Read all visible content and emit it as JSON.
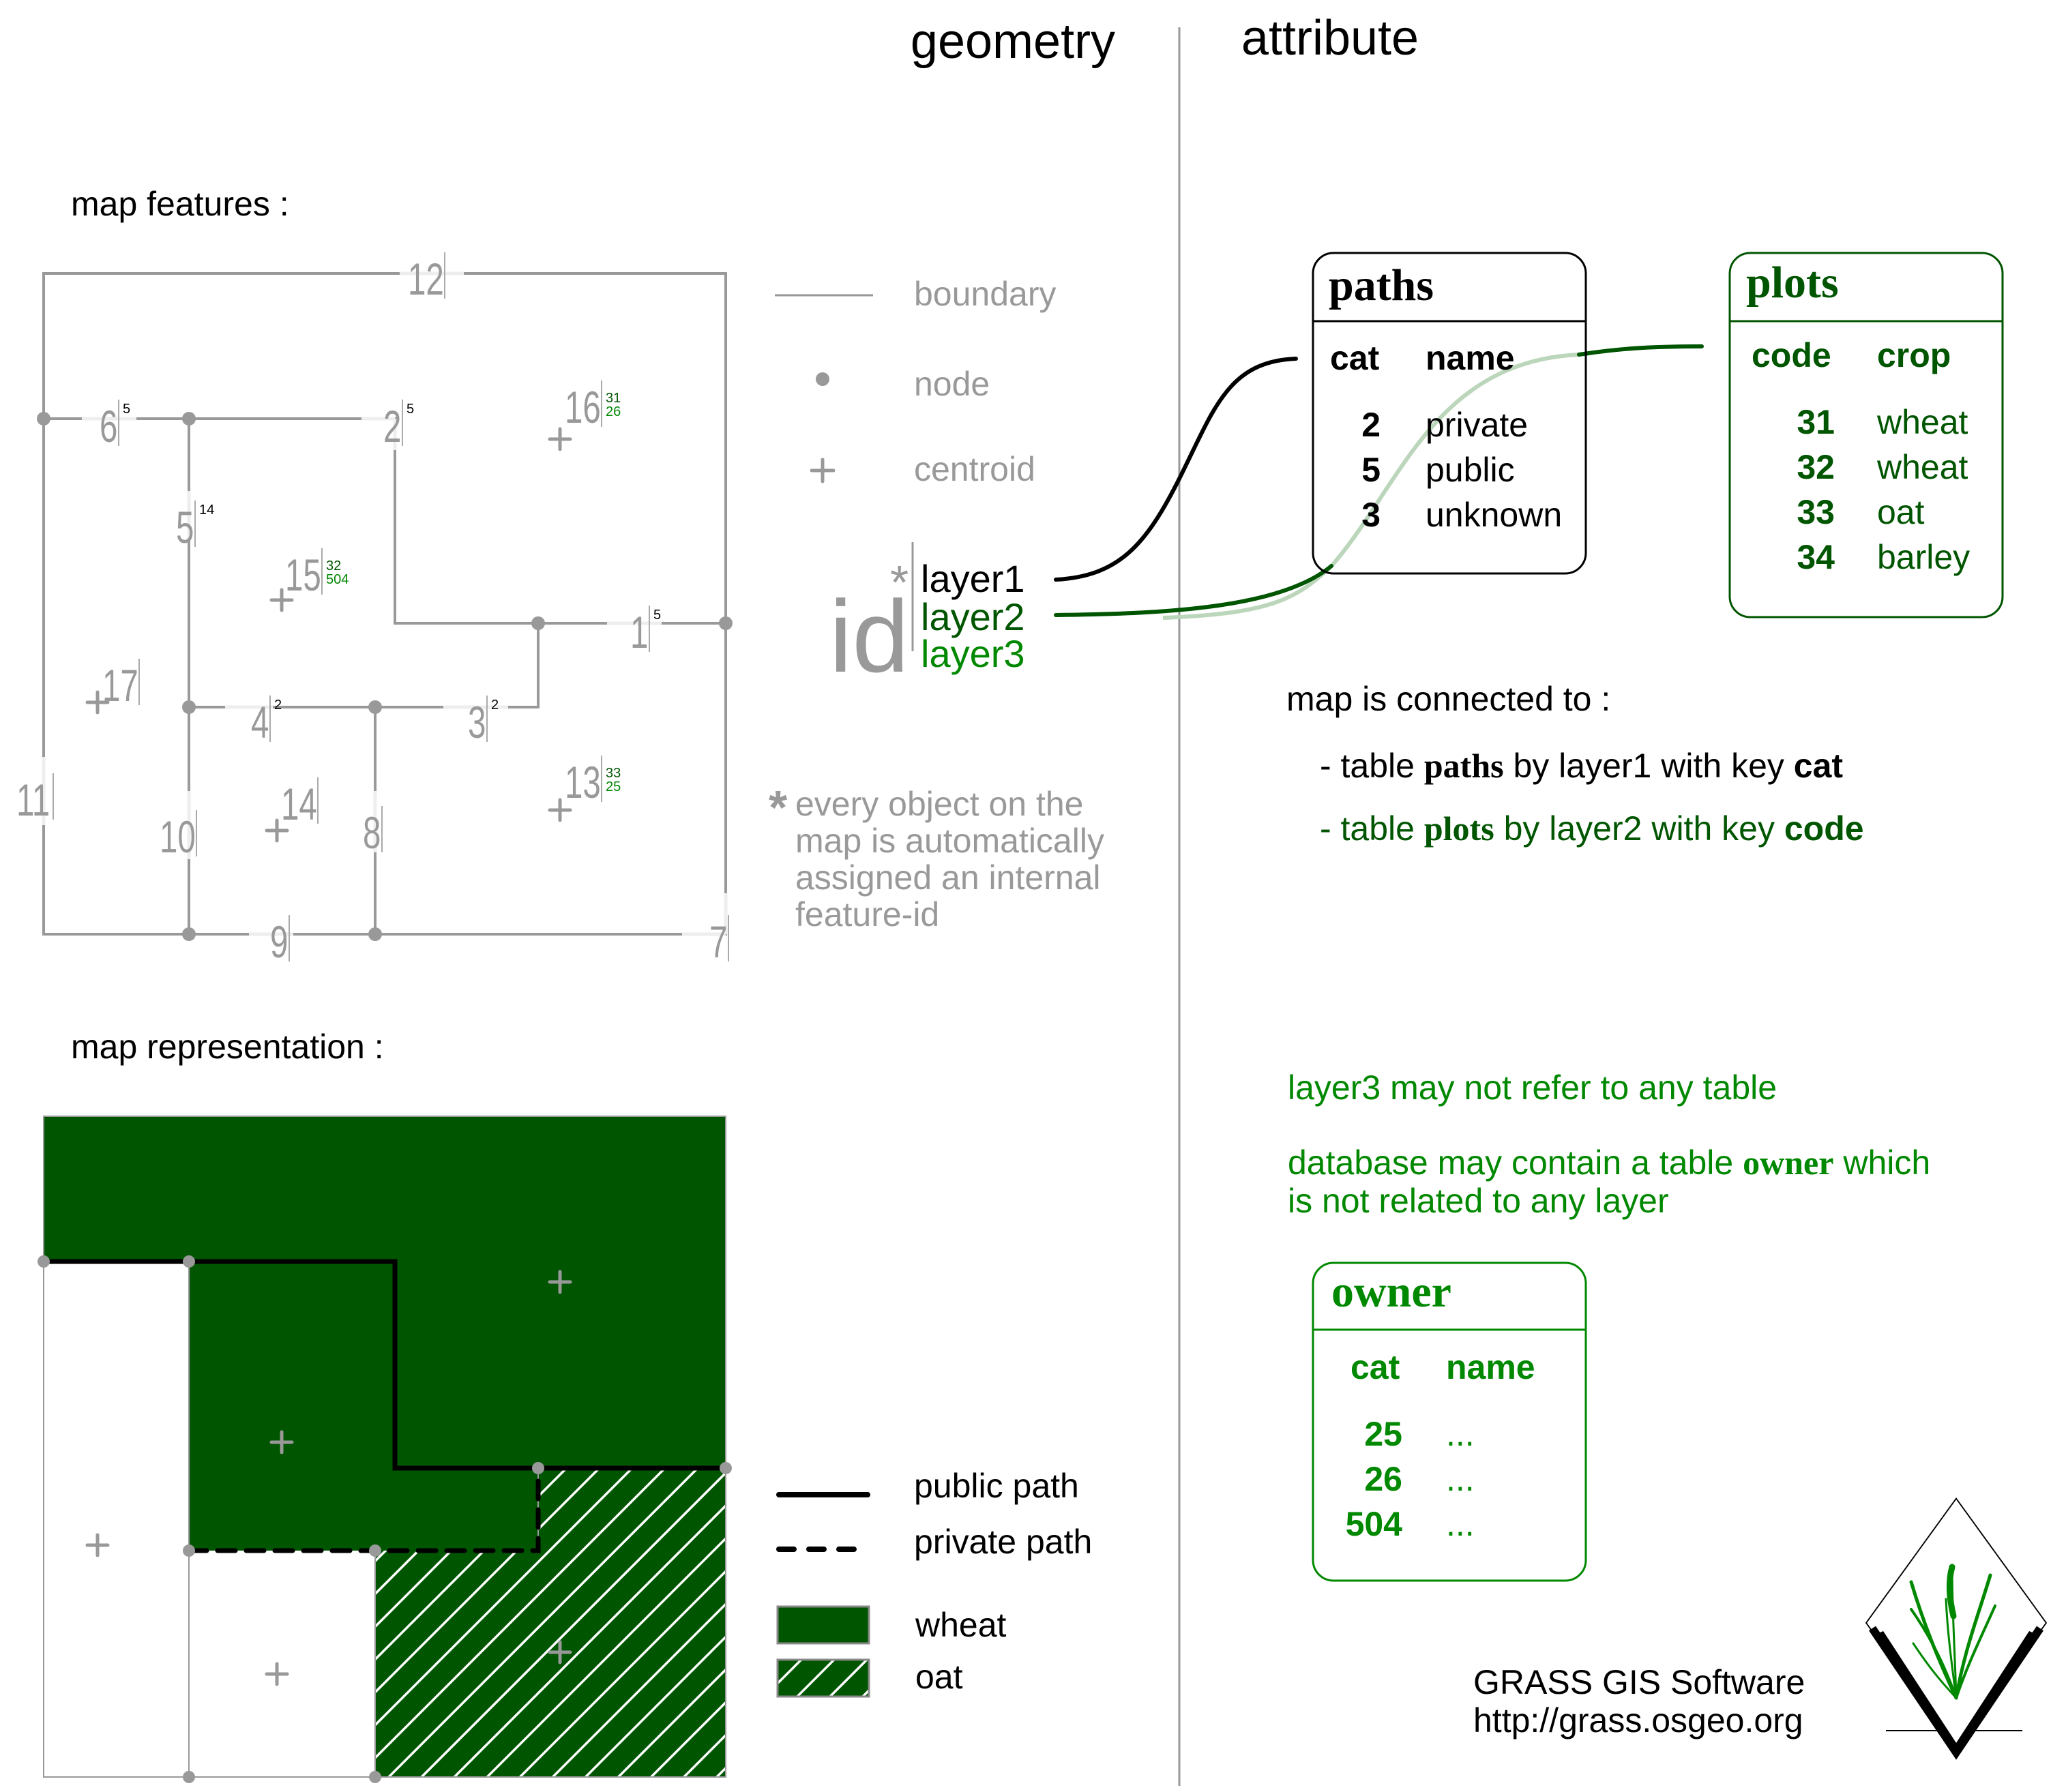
{
  "colors": {
    "boundary": "#999999",
    "wheat": "#005500",
    "layer2": "#005500",
    "layer3": "#008800",
    "text": "#000000",
    "muted": "#999999"
  },
  "header": {
    "geometry_title": "geometry",
    "attribute_title": "attribute"
  },
  "geometry": {
    "map_features_label": "map features :",
    "map_representation_label": "map representation :",
    "feature_labels": [
      {
        "id": "12",
        "sup": "",
        "kind": "boundary"
      },
      {
        "id": "6",
        "sup": "5",
        "kind": "boundary"
      },
      {
        "id": "2",
        "sup": "5",
        "kind": "boundary"
      },
      {
        "id": "5",
        "sup": "14",
        "kind": "boundary"
      },
      {
        "id": "1",
        "sup": "5",
        "kind": "boundary"
      },
      {
        "id": "4",
        "sup": "2",
        "kind": "boundary"
      },
      {
        "id": "3",
        "sup": "2",
        "kind": "boundary"
      },
      {
        "id": "11",
        "sup": "",
        "kind": "boundary"
      },
      {
        "id": "10",
        "sup": "",
        "kind": "boundary"
      },
      {
        "id": "8",
        "sup": "",
        "kind": "boundary"
      },
      {
        "id": "9",
        "sup": "",
        "kind": "boundary"
      },
      {
        "id": "7",
        "sup": "",
        "kind": "boundary"
      },
      {
        "id": "16",
        "layer2": "31",
        "layer3": "26",
        "kind": "centroid"
      },
      {
        "id": "15",
        "layer2": "32",
        "layer3": "504",
        "kind": "centroid"
      },
      {
        "id": "17",
        "layer2": "",
        "layer3": "",
        "kind": "centroid"
      },
      {
        "id": "14",
        "layer2": "",
        "layer3": "",
        "kind": "centroid"
      },
      {
        "id": "13",
        "layer2": "33",
        "layer3": "25",
        "kind": "centroid"
      }
    ],
    "legend": {
      "boundary": "boundary",
      "node": "node",
      "centroid": "centroid"
    },
    "id_block": {
      "id": "id",
      "star": "*",
      "layer1": "layer1",
      "layer2": "layer2",
      "layer3": "layer3"
    },
    "footnote": {
      "star": "*",
      "lines": [
        "every object on the",
        "map is automatically",
        "assigned an internal",
        "feature-id"
      ]
    },
    "rep_legend": {
      "public_path": "public path",
      "private_path": "private path",
      "wheat": "wheat",
      "oat": "oat"
    }
  },
  "attribute": {
    "tables": {
      "paths": {
        "title": "paths",
        "columns": [
          "cat",
          "name"
        ],
        "rows": [
          [
            "2",
            "private"
          ],
          [
            "5",
            "public"
          ],
          [
            "3",
            "unknown"
          ]
        ]
      },
      "plots": {
        "title": "plots",
        "columns": [
          "code",
          "crop"
        ],
        "rows": [
          [
            "31",
            "wheat"
          ],
          [
            "32",
            "wheat"
          ],
          [
            "33",
            "oat"
          ],
          [
            "34",
            "barley"
          ]
        ]
      },
      "owner": {
        "title": "owner",
        "columns": [
          "cat",
          "name"
        ],
        "rows": [
          [
            "25",
            "..."
          ],
          [
            "26",
            "..."
          ],
          [
            "504",
            "..."
          ]
        ]
      }
    },
    "connection": {
      "intro": "map is connected to :",
      "line1": {
        "prefix": "- table ",
        "table": "paths",
        "middle": " by layer1 with key ",
        "key": "cat"
      },
      "line2": {
        "prefix": "- table ",
        "table": "plots",
        "middle": " by layer2 with key ",
        "key": "code"
      }
    },
    "note_layer3": "layer3 may not refer to any table",
    "note_owner": {
      "prefix": "database may contain a table ",
      "table": "owner",
      "suffix": " which",
      "line2": "is not related to any layer"
    }
  },
  "footer": {
    "software": "GRASS GIS Software",
    "url": "http://grass.osgeo.org"
  }
}
